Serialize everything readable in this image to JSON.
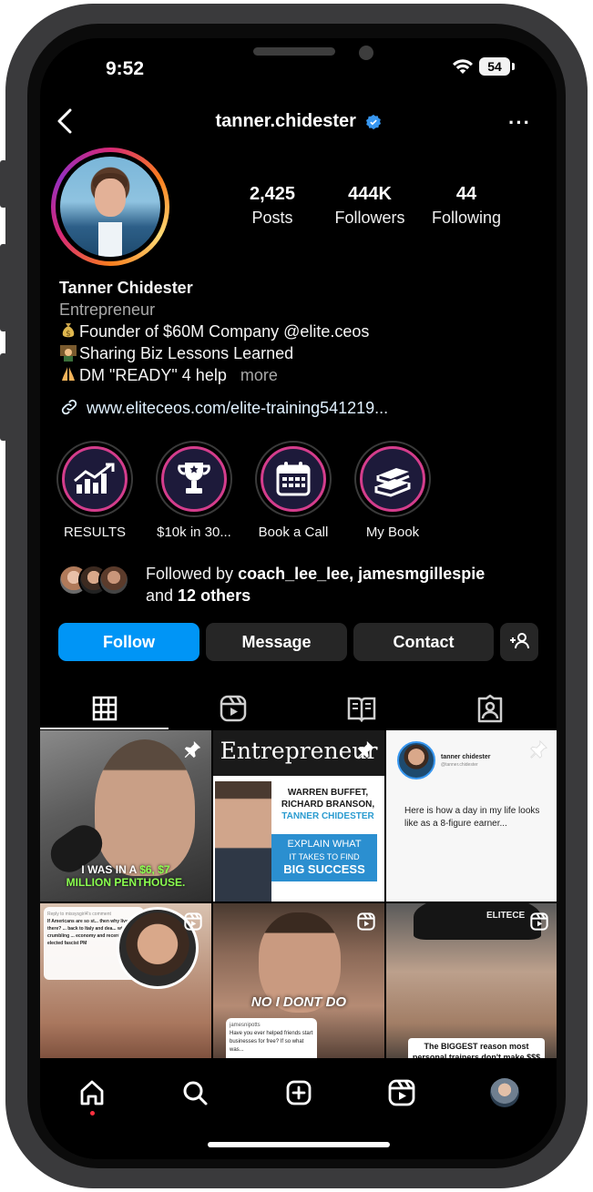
{
  "status": {
    "time": "9:52",
    "battery": "54"
  },
  "header": {
    "username": "tanner.chidester",
    "more": "···"
  },
  "stats": [
    {
      "value": "2,425",
      "label": "Posts"
    },
    {
      "value": "444K",
      "label": "Followers"
    },
    {
      "value": "44",
      "label": "Following"
    }
  ],
  "bio": {
    "name": "Tanner Chidester",
    "category": "Entrepreneur",
    "lines": [
      "Founder of $60M Company @elite.ceos",
      "Sharing Biz Lessons Learned",
      "DM \"READY\" 4 help"
    ],
    "more": "more",
    "link": "www.eliteceos.com/elite-training541219..."
  },
  "highlights": [
    {
      "label": "RESULTS",
      "icon": "chart-up-icon"
    },
    {
      "label": "$10k in 30...",
      "icon": "trophy-icon"
    },
    {
      "label": "Book a Call",
      "icon": "calendar-icon"
    },
    {
      "label": "My Book",
      "icon": "books-icon"
    }
  ],
  "followed_by": {
    "prefix": "Followed by ",
    "names": "coach_lee_lee, jamesmgillespie",
    "and": "and ",
    "others": "12 others"
  },
  "actions": {
    "follow": "Follow",
    "message": "Message",
    "contact": "Contact"
  },
  "posts": [
    {
      "caption_1": "I WAS IN A ",
      "caption_2": "$6, $7",
      "caption_3": "MILLION PENTHOUSE."
    },
    {
      "title": "Entrepreneur",
      "line1": "WARREN BUFFET,",
      "line2": "RICHARD BRANSON,",
      "line3": "TANNER CHIDESTER",
      "line4": "EXPLAIN WHAT",
      "line5": "IT TAKES TO FIND",
      "line6": "BIG SUCCESS"
    },
    {
      "author": "tanner chidester",
      "handle": "@tanner.chidester",
      "text": "Here is how a day in my life looks like as a 8-figure earner..."
    },
    {
      "reply": "Reply to missysgirl4's comment",
      "text": "If Americans are so st... then why live there? ... back to Italy and dea... with your crumbling ... economy and recent ... elected fascist PM"
    },
    {
      "caption": "NO I DONT DO",
      "user": "jamesnipotts",
      "q": "Have you ever helped friends start businesses for free? If so what was..."
    },
    {
      "cap": "ELITECE",
      "caption": "The BIGGEST reason most personal trainers don't make $$$"
    }
  ]
}
